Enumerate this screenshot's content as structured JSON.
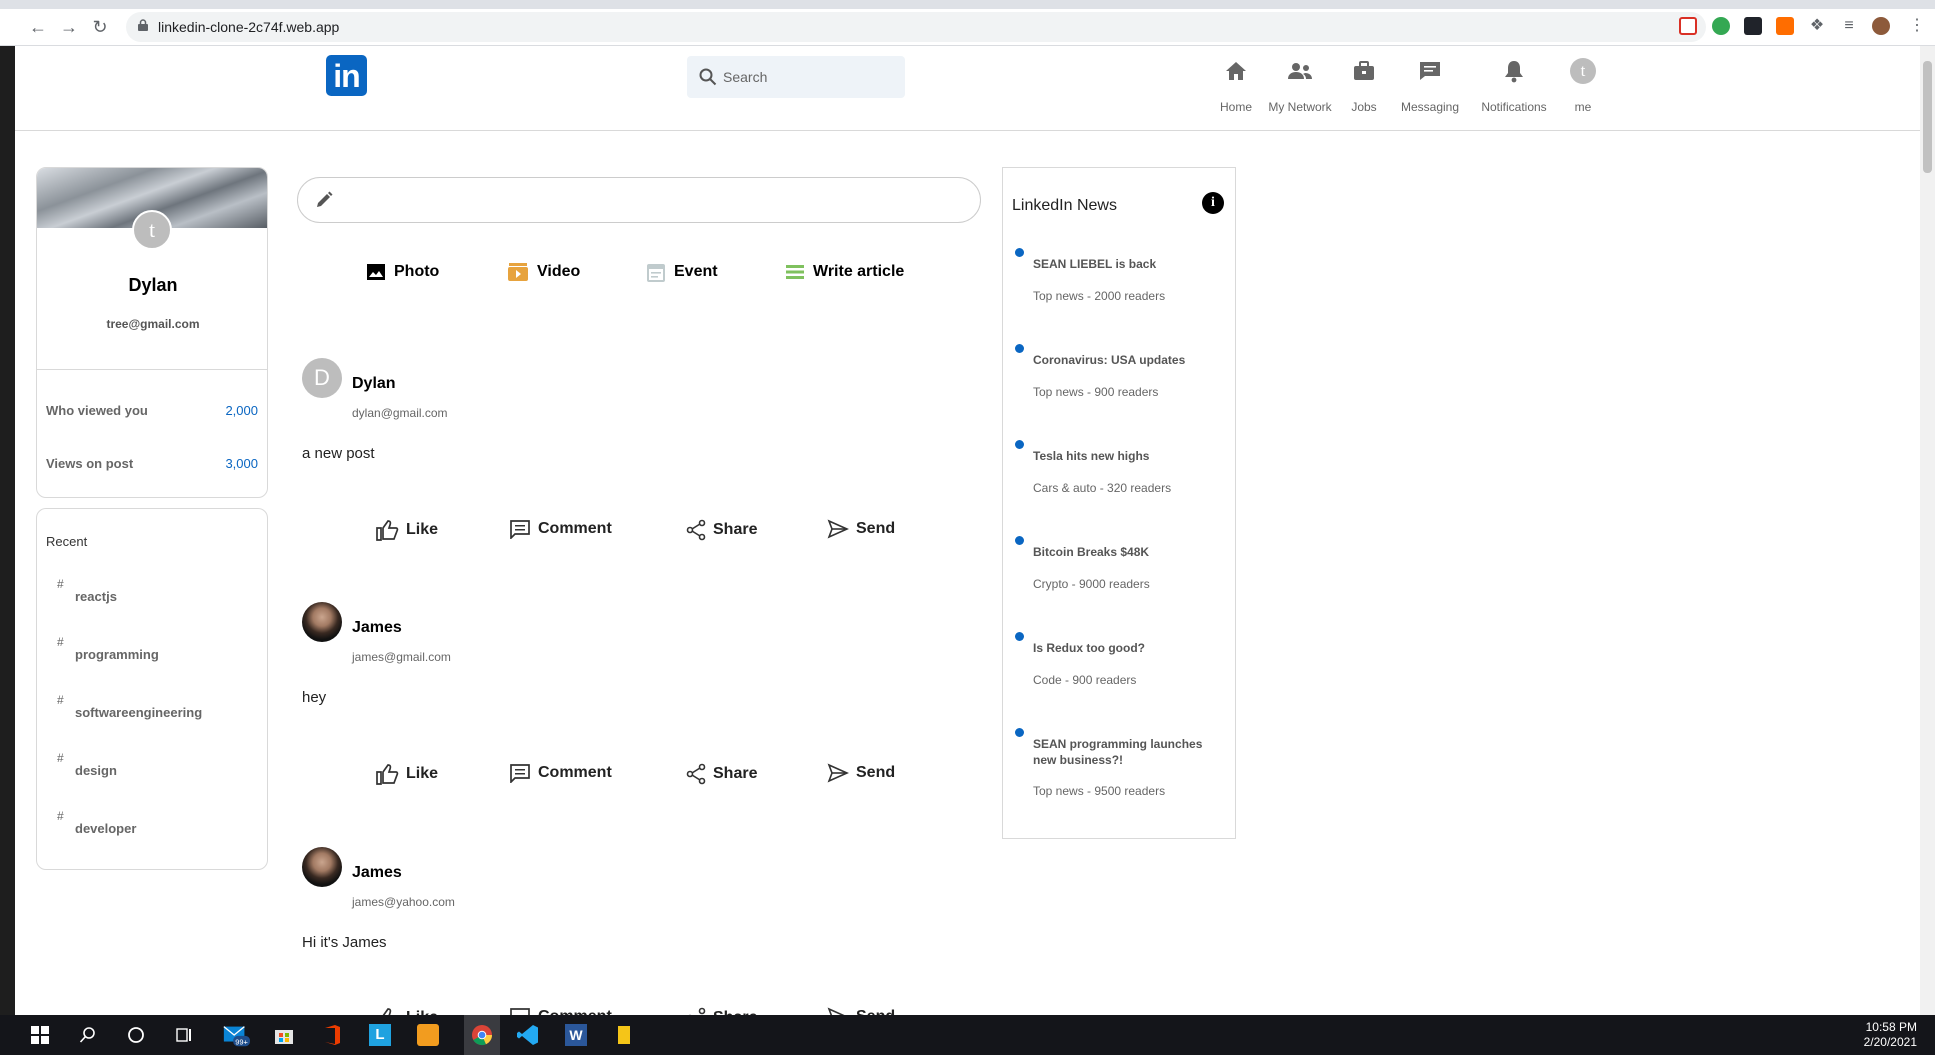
{
  "browser": {
    "url": "linkedin-clone-2c74f.web.app"
  },
  "header": {
    "logo": "in",
    "search_placeholder": "Search",
    "nav": [
      {
        "label": "Home",
        "icon": "home-icon"
      },
      {
        "label": "My Network",
        "icon": "network-icon"
      },
      {
        "label": "Jobs",
        "icon": "briefcase-icon"
      },
      {
        "label": "Messaging",
        "icon": "chat-icon"
      },
      {
        "label": "Notifications",
        "icon": "bell-icon"
      },
      {
        "label": "me",
        "icon": "avatar",
        "avatar_letter": "t"
      }
    ]
  },
  "sidebar": {
    "avatar_letter": "t",
    "name": "Dylan",
    "email": "tree@gmail.com",
    "stats": [
      {
        "label": "Who viewed you",
        "value": "2,000"
      },
      {
        "label": "Views on post",
        "value": "3,000"
      }
    ],
    "recent_title": "Recent",
    "recent": [
      "reactjs",
      "programming",
      "softwareengineering",
      "design",
      "developer"
    ],
    "hash": "#"
  },
  "feed": {
    "input_options": [
      {
        "label": "Photo",
        "icon": "photo-icon",
        "color": "#000000"
      },
      {
        "label": "Video",
        "icon": "video-icon",
        "color": "#e7a33e"
      },
      {
        "label": "Event",
        "icon": "event-icon",
        "color": "#c0cbcd"
      },
      {
        "label": "Write article",
        "icon": "article-icon",
        "color": "#7fc15e"
      }
    ],
    "posts": [
      {
        "name": "Dylan",
        "email": "dylan@gmail.com",
        "message": "a new post",
        "avatar_letter": "D"
      },
      {
        "name": "James",
        "email": "james@gmail.com",
        "message": "hey",
        "avatar_letter": ""
      },
      {
        "name": "James",
        "email": "james@yahoo.com",
        "message": "Hi it's James",
        "avatar_letter": ""
      }
    ],
    "actions": [
      "Like",
      "Comment",
      "Share",
      "Send"
    ]
  },
  "news": {
    "title": "LinkedIn News",
    "info": "i",
    "items": [
      {
        "heading": "SEAN LIEBEL is back",
        "subtitle": "Top news - 2000 readers"
      },
      {
        "heading": "Coronavirus: USA updates",
        "subtitle": "Top news - 900 readers"
      },
      {
        "heading": "Tesla hits new highs",
        "subtitle": "Cars & auto - 320 readers"
      },
      {
        "heading": "Bitcoin Breaks $48K",
        "subtitle": "Crypto - 9000 readers"
      },
      {
        "heading": "Is Redux too good?",
        "subtitle": "Code - 900 readers"
      },
      {
        "heading": "SEAN programming launches new business?!",
        "subtitle": "Top news - 9500 readers"
      }
    ]
  },
  "taskbar": {
    "badge": "99+",
    "time": "10:58 PM",
    "date": "2/20/2021"
  },
  "colors": {
    "brand": "#0a66c2",
    "border": "#d9d9d9"
  }
}
